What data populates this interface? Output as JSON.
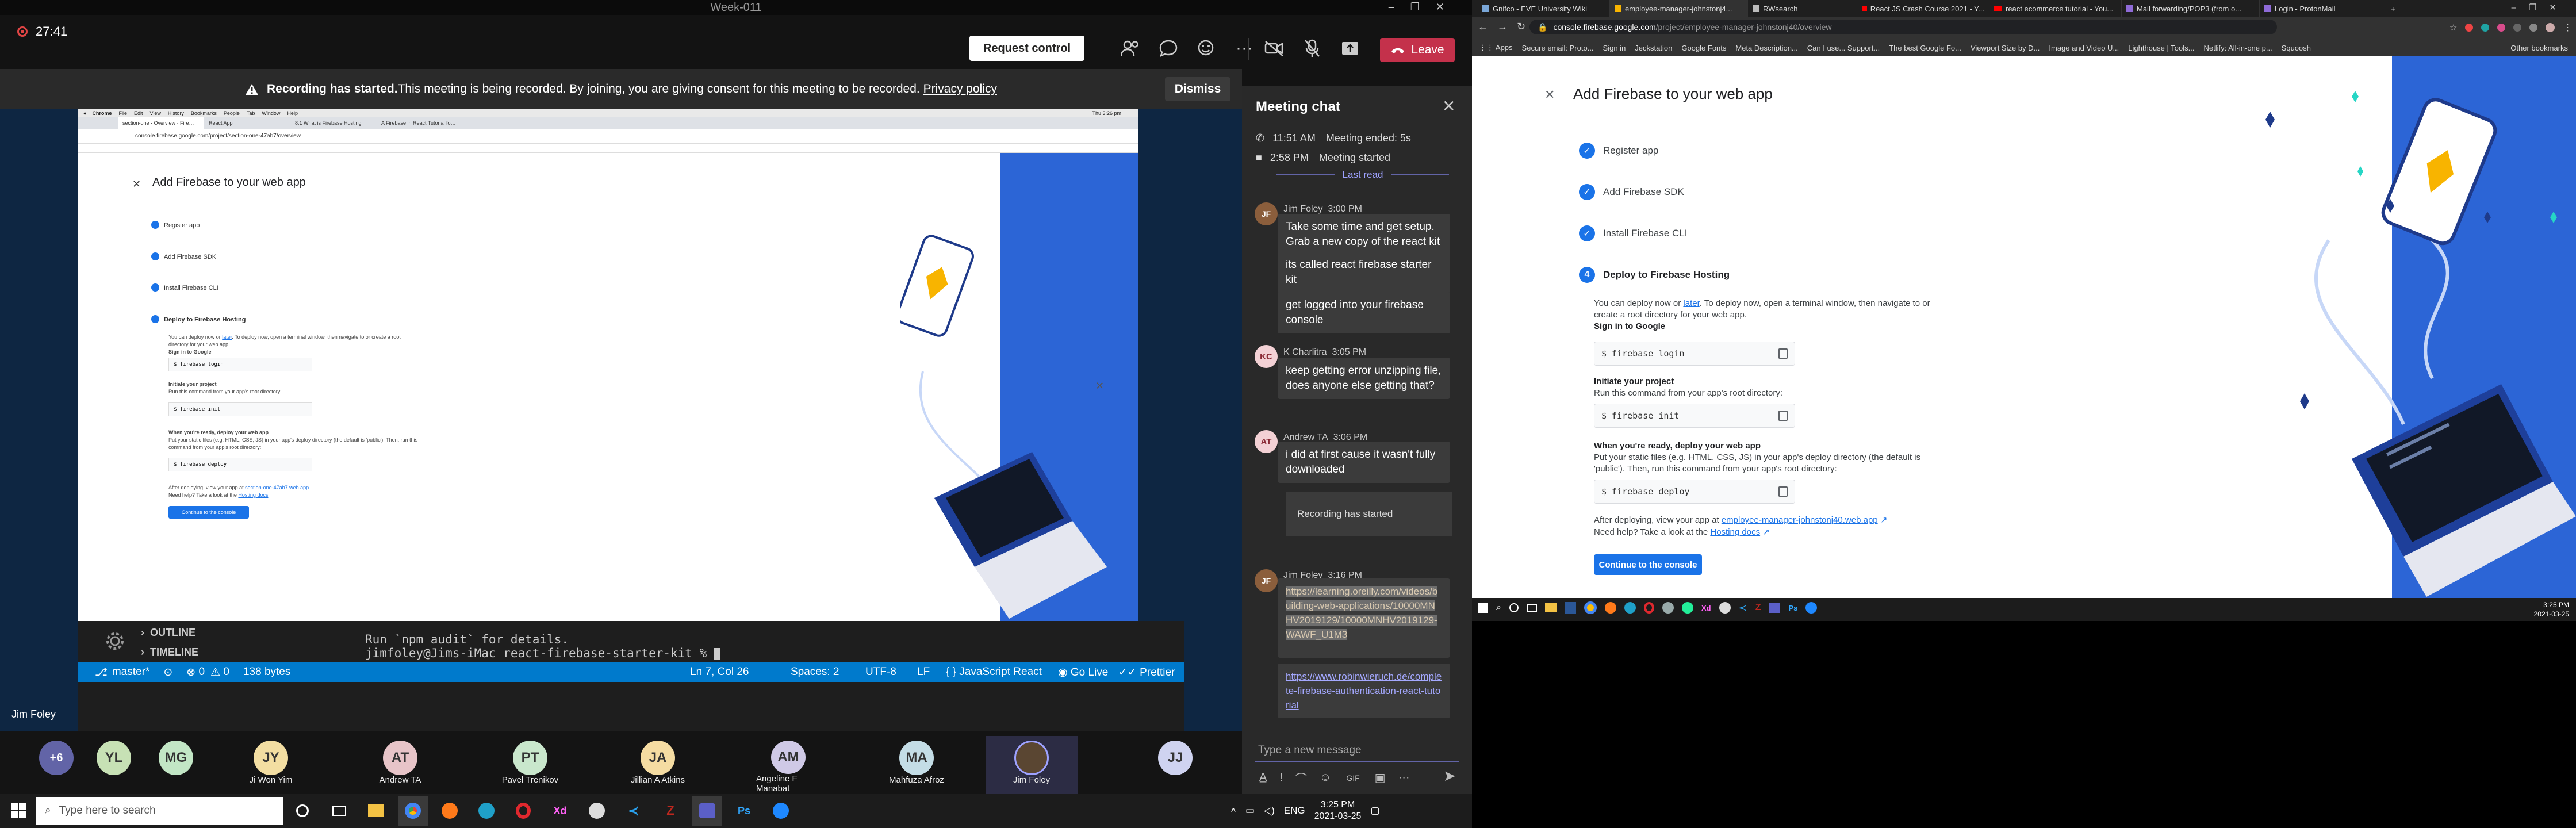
{
  "meeting": {
    "title": "Week-011",
    "time": "27:41",
    "request_control": "Request control",
    "leave": "Leave",
    "presenter": "Jim Foley"
  },
  "recording_banner": {
    "strong": "Recording has started.",
    "text": " This meeting is being recorded. By joining, you are giving consent for this meeting to be recorded.",
    "link": "Privacy policy",
    "dismiss": "Dismiss"
  },
  "shared": {
    "menubar": [
      "Chrome",
      "File",
      "Edit",
      "View",
      "History",
      "Bookmarks",
      "People",
      "Tab",
      "Window",
      "Help"
    ],
    "clock": "Thu 3:26 pm",
    "tabs": [
      "section-one · Overview · Fire…",
      "React App",
      "8.1 What is Firebase Hosting",
      "A Firebase in React Tutorial fo…"
    ],
    "url": "console.firebase.google.com/project/section-one-47ab7/overview"
  },
  "firebase": {
    "title": "Add Firebase to your web app",
    "steps": [
      "Register app",
      "Add Firebase SDK",
      "Install Firebase CLI"
    ],
    "active_step_number": "4",
    "active_step": "Deploy to Firebase Hosting",
    "intro1": "You can deploy now or ",
    "later": "later",
    "intro2": ". To deploy now, open a terminal window, then navigate to or create a root directory for your web app.",
    "signin": "Sign in to Google",
    "cmd1": "$ firebase login",
    "init_title": "Initiate your project",
    "init_text": "Run this command from your app's root directory:",
    "cmd2": "$ firebase init",
    "ready_title": "When you're ready, deploy your web app",
    "ready_text": "Put your static files (e.g. HTML, CSS, JS) in your app's deploy directory (the default is 'public'). Then, run this command from your app's root directory:",
    "cmd3": "$ firebase deploy",
    "after": "After deploying, view your app at ",
    "app_url": "employee-manager-johnstonj40.web.app",
    "small_app_url": "section-one-47ab7.web.app",
    "help": "Need help? Take a look at the ",
    "docs": "Hosting docs",
    "continue": "Continue to the console"
  },
  "vscode": {
    "outline": "OUTLINE",
    "timeline": "TIMELINE",
    "line1": "Run `npm audit` for details.",
    "prompt": "jimfoley@Jims-iMac react-firebase-starter-kit % ",
    "branch": "master*",
    "errors": "0",
    "warnings": "0",
    "bytes": "138 bytes",
    "pos": "Ln 7, Col 26",
    "spaces": "Spaces: 2",
    "enc": "UTF-8",
    "eol": "LF",
    "lang": "JavaScript React",
    "golive": "Go Live",
    "prettier": "Prettier"
  },
  "chat": {
    "title": "Meeting chat",
    "ev1_time": "11:51 AM",
    "ev1_text": "Meeting ended: 5s",
    "ev2_time": "2:58 PM",
    "ev2_text": "Meeting started",
    "last_read": "Last read",
    "messages": [
      {
        "author": "Jim Foley",
        "time": "3:00 PM",
        "lines": [
          "Take some time and get setup. Grab a new copy of the react kit",
          "its called react firebase starter kit",
          "get logged into your firebase console"
        ]
      },
      {
        "author": "K Charlitra",
        "initials": "KC",
        "time": "3:05 PM",
        "lines": [
          "keep getting error unzipping file, does anyone else getting that?"
        ]
      },
      {
        "author": "Andrew TA",
        "initials": "AT",
        "time": "3:06 PM",
        "lines": [
          "i did at first cause it wasn't fully downloaded"
        ]
      },
      {
        "author": "Jim Foley",
        "time": "3:16 PM",
        "lines": [
          "https://learning.oreilly.com/videos/building-web-applications/10000MNHV2019129/10000MNHV2019129-WAWF_U1M3",
          "https://www.robinwieruch.de/complete-firebase-authentication-react-tutorial"
        ]
      }
    ],
    "rec_started": "Recording has started",
    "placeholder": "Type a new message"
  },
  "participants": [
    {
      "initials": "+6",
      "name": "",
      "color": "#6264a7"
    },
    {
      "initials": "YL",
      "name": "",
      "color": "#c7e1b5"
    },
    {
      "initials": "MG",
      "name": "",
      "color": "#c2e6c5"
    },
    {
      "initials": "JY",
      "name": "Ji Won Yim",
      "color": "#f3dea2"
    },
    {
      "initials": "AT",
      "name": "Andrew TA",
      "color": "#e7c4c8"
    },
    {
      "initials": "PT",
      "name": "Pavel Trenikov",
      "color": "#c9e7cc"
    },
    {
      "initials": "JA",
      "name": "Jillian A Atkins",
      "color": "#f5dca2"
    },
    {
      "initials": "AM",
      "name": "Angeline F Manabat",
      "color": "#cfc9e6"
    },
    {
      "initials": "MA",
      "name": "Mahfuza Afroz",
      "color": "#c4dde6"
    },
    {
      "initials": "",
      "name": "Jim Foley",
      "color": "#5a4632"
    },
    {
      "initials": "JJ",
      "name": "",
      "color": "#cfd3f0"
    }
  ],
  "taskbar_left": {
    "search": "Type here to search",
    "time": "3:25 PM",
    "date": "2021-03-25",
    "lang": "ENG"
  },
  "browser": {
    "tabs": [
      "Gnifco - EVE University Wiki",
      "employee-manager-johnstonj4...",
      "RWsearch",
      "React JS Crash Course 2021 - Y...",
      "react ecommerce tutorial - You...",
      "Mail forwarding/POP3 (from o...",
      "Login - ProtonMail"
    ],
    "url_host": "console.firebase.google.com",
    "url_path": "/project/employee-manager-johnstonj40/overview",
    "bookmarks": [
      "Apps",
      "Secure email: Proto...",
      "Sign in",
      "Jeckstation",
      "Google Fonts",
      "Meta Description...",
      "Can I use... Support...",
      "The best Google Fo...",
      "Viewport Size by D...",
      "Image and Video U...",
      "Lighthouse | Tools...",
      "Netlify: All-in-one p...",
      "Squoosh",
      "Other bookmarks"
    ]
  },
  "taskbar_right": {
    "time": "3:25 PM",
    "date": "2021-03-25"
  },
  "colors": {
    "accent": "#1a73e8",
    "leave": "#c4314b",
    "teams_purple": "#6264a7",
    "firebase_blue": "#2c65d6"
  }
}
